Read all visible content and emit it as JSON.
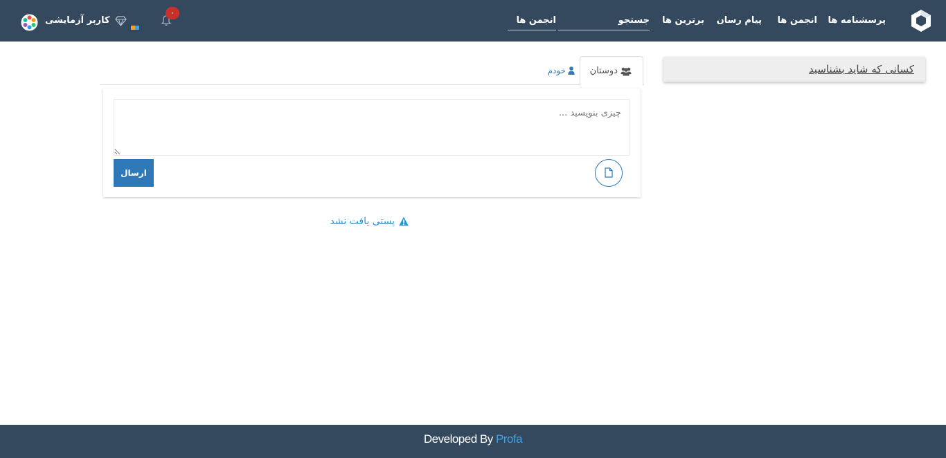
{
  "navbar": {
    "links": [
      "پرسشنامه ها",
      "انجمن ها",
      "پیام رسان",
      "برترین ها"
    ],
    "search_label": "جستجو",
    "forums_field": "انجمن ها",
    "user_name": "کاربر آزمایشی",
    "notification_count": "۰",
    "icons": [
      "logo-icon",
      "bell-icon",
      "gem-icon",
      "coins-icon",
      "avatar"
    ]
  },
  "sidebar": {
    "people_title": "کسانی که شاید بشناسید"
  },
  "tabs": {
    "friends": "دوستان",
    "mine": "خودم",
    "active": "friends"
  },
  "composer": {
    "placeholder": "چیزی بنویسید ...",
    "send_label": "ارسال"
  },
  "feed": {
    "empty_message": "پستی یافت نشد"
  },
  "footer": {
    "developed_by": "Developed By",
    "developer": "Profa"
  },
  "colors": {
    "navbar": "#34495e",
    "primary": "#2e78b7",
    "badge": "#c9302c",
    "info": "#1e9bd7"
  }
}
